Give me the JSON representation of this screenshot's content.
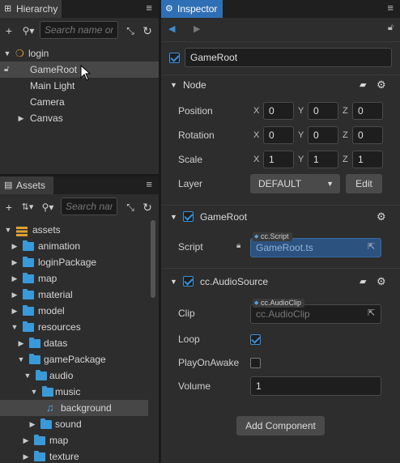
{
  "hierarchy": {
    "tab_label": "Hierarchy",
    "search_placeholder": "Search name or UUID",
    "items": [
      {
        "label": "login"
      },
      {
        "label": "GameRoot"
      },
      {
        "label": "Main Light"
      },
      {
        "label": "Camera"
      },
      {
        "label": "Canvas"
      }
    ]
  },
  "assets": {
    "tab_label": "Assets",
    "search_placeholder": "Search name",
    "items": [
      {
        "label": "assets"
      },
      {
        "label": "animation"
      },
      {
        "label": "loginPackage"
      },
      {
        "label": "map"
      },
      {
        "label": "material"
      },
      {
        "label": "model"
      },
      {
        "label": "resources"
      },
      {
        "label": "datas"
      },
      {
        "label": "gamePackage"
      },
      {
        "label": "audio"
      },
      {
        "label": "music"
      },
      {
        "label": "background"
      },
      {
        "label": "sound"
      },
      {
        "label": "map"
      },
      {
        "label": "texture"
      }
    ]
  },
  "inspector": {
    "tab_label": "Inspector",
    "node_name": "GameRoot",
    "node_section": {
      "title": "Node",
      "position_label": "Position",
      "rotation_label": "Rotation",
      "scale_label": "Scale",
      "layer_label": "Layer",
      "axis_x": "X",
      "axis_y": "Y",
      "axis_z": "Z",
      "position": {
        "x": "0",
        "y": "0",
        "z": "0"
      },
      "rotation": {
        "x": "0",
        "y": "0",
        "z": "0"
      },
      "scale": {
        "x": "1",
        "y": "1",
        "z": "1"
      },
      "layer_value": "DEFAULT",
      "edit_label": "Edit"
    },
    "script_section": {
      "title": "GameRoot",
      "script_label": "Script",
      "script_tag": "cc.Script",
      "script_value": "GameRoot.ts"
    },
    "audio_section": {
      "title": "cc.AudioSource",
      "clip_label": "Clip",
      "clip_tag": "cc.AudioClip",
      "clip_value": "cc.AudioClip",
      "loop_label": "Loop",
      "loop_checked": true,
      "play_on_awake_label": "PlayOnAwake",
      "play_on_awake_checked": false,
      "volume_label": "Volume",
      "volume_value": "1"
    },
    "add_component_label": "Add Component"
  },
  "colors": {
    "accent": "#2f6fb5",
    "folder": "#3a9ad9",
    "panel_bg": "#2d2d2d"
  }
}
